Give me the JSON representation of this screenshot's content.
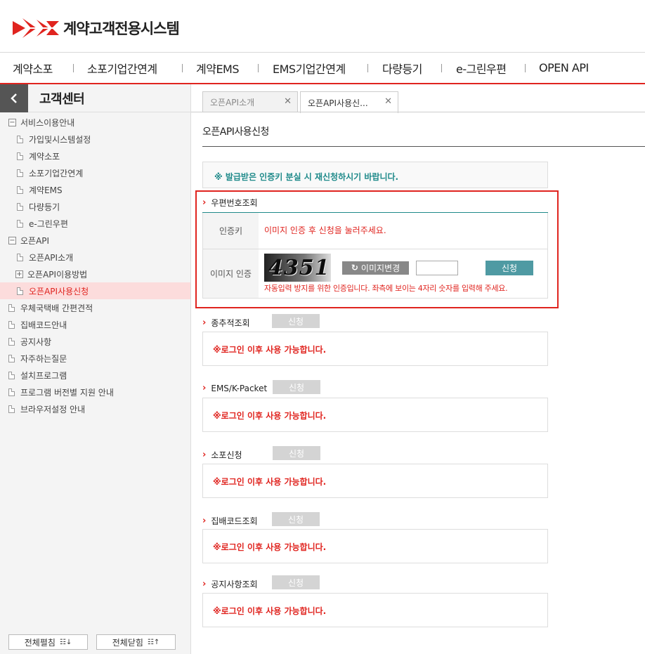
{
  "header": {
    "logo_text": "계약고객전용시스템"
  },
  "gnb": {
    "items": [
      "계약소포",
      "소포기업간연계",
      "계약EMS",
      "EMS기업간연계",
      "다량등기",
      "e-그린우편",
      "OPEN API"
    ]
  },
  "lnb": {
    "back_icon": "chevron-left-icon",
    "title": "고객센터",
    "tree": [
      {
        "label": "서비스이용안내",
        "type": "folder-open",
        "level": 0
      },
      {
        "label": "가입및시스템설정",
        "type": "doc",
        "level": 1
      },
      {
        "label": "계약소포",
        "type": "doc",
        "level": 1
      },
      {
        "label": "소포기업간연계",
        "type": "doc",
        "level": 1
      },
      {
        "label": "계약EMS",
        "type": "doc",
        "level": 1
      },
      {
        "label": "다량등기",
        "type": "doc",
        "level": 1
      },
      {
        "label": "e-그린우편",
        "type": "doc",
        "level": 1
      },
      {
        "label": "오픈API",
        "type": "folder-open",
        "level": 0
      },
      {
        "label": "오픈API소개",
        "type": "doc",
        "level": 1
      },
      {
        "label": "오픈API이용방법",
        "type": "folder-closed",
        "level": 1
      },
      {
        "label": "오픈API사용신청",
        "type": "doc",
        "level": 1,
        "active": true
      },
      {
        "label": "우체국택배 간편견적",
        "type": "doc",
        "level": 0
      },
      {
        "label": "집배코드안내",
        "type": "doc",
        "level": 0
      },
      {
        "label": "공지사항",
        "type": "doc",
        "level": 0
      },
      {
        "label": "자주하는질문",
        "type": "doc",
        "level": 0
      },
      {
        "label": "설치프로그램",
        "type": "doc",
        "level": 0
      },
      {
        "label": "프로그램 버전별 지원 안내",
        "type": "doc",
        "level": 0
      },
      {
        "label": "브라우저설정 안내",
        "type": "doc",
        "level": 0
      }
    ],
    "expand_all": "전체펼침",
    "collapse_all": "전체닫힘"
  },
  "tabs": [
    {
      "label": "오픈API소개",
      "close": "✕"
    },
    {
      "label": "오픈API사용신...",
      "close": "✕",
      "active": true
    }
  ],
  "main": {
    "title": "오픈API사용신청",
    "notice": "※ 발급받은 인증키 분실 시 재신청하시기 바랍니다.",
    "zip_section": {
      "title": "우편번호조회",
      "auth_key_label": "인증키",
      "auth_key_msg": "이미지 인증 후 신청을 눌러주세요.",
      "image_auth_label": "이미지 인증",
      "captcha_text": "4351",
      "refresh_label": "이미지변경",
      "apply_label": "신청",
      "help_msg": "자동입력 방지를 위한 인증입니다. 좌측에 보이는 4자리 숫자를 입력해 주세요."
    },
    "sections": [
      {
        "title": "종추적조회",
        "button": "신청",
        "msg": "※로그인 이후 사용 가능합니다."
      },
      {
        "title": "EMS/K-Packet",
        "button": "신청",
        "msg": "※로그인 이후 사용 가능합니다."
      },
      {
        "title": "소포신청",
        "button": "신청",
        "msg": "※로그인 이후 사용 가능합니다."
      },
      {
        "title": "집배코드조회",
        "button": "신청",
        "msg": "※로그인 이후 사용 가능합니다."
      },
      {
        "title": "공지사항조회",
        "button": "신청",
        "msg": "※로그인 이후 사용 가능합니다."
      }
    ]
  },
  "colors": {
    "brand_red": "#e0241f",
    "teal": "#1f8a8a",
    "apply_button": "#4f9aa3"
  }
}
